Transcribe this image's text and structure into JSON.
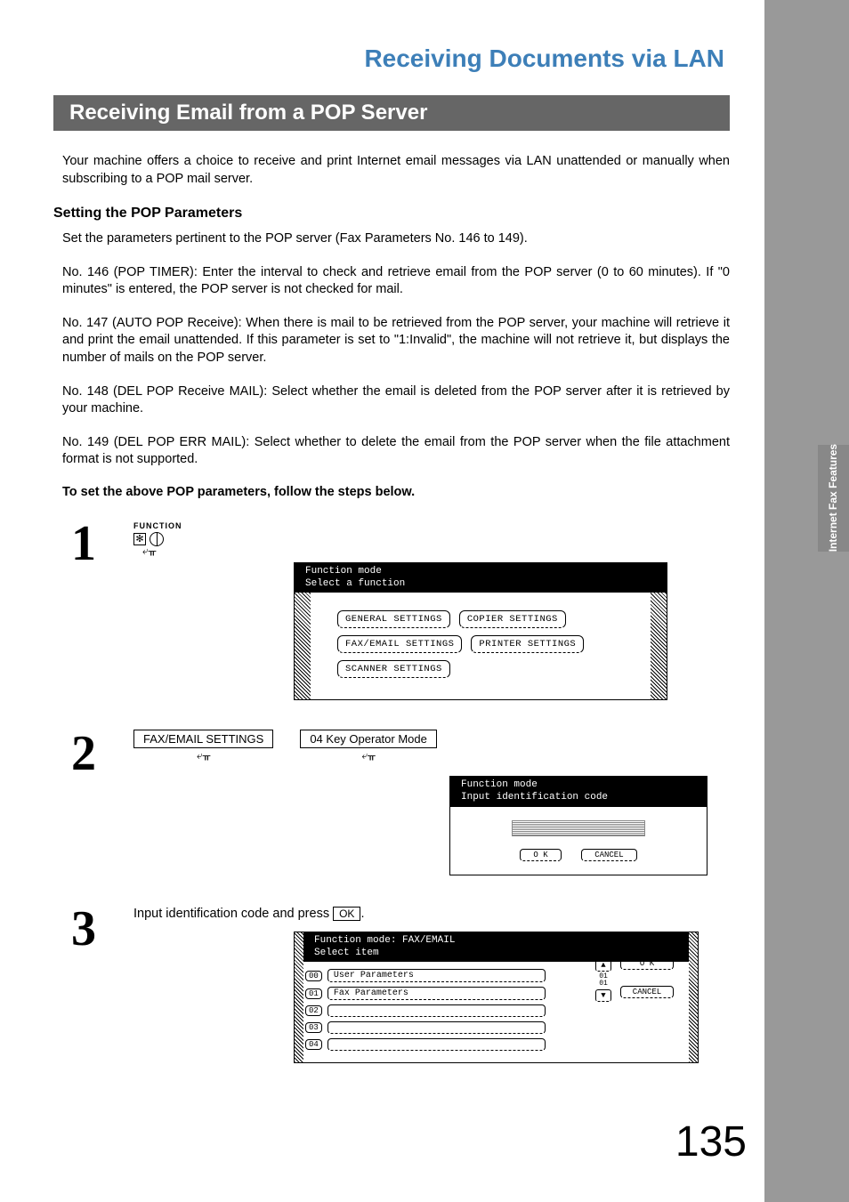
{
  "pageNumber": "135",
  "sideTab": "Internet Fax\nFeatures",
  "mainTitle": "Receiving Documents via LAN",
  "sectionBar": "Receiving Email from a POP Server",
  "intro": "Your machine offers a choice to receive and print Internet email messages via LAN unattended or manually when subscribing to a POP mail server.",
  "subHeading": "Setting the POP Parameters",
  "p1": "Set the parameters pertinent to the POP server (Fax Parameters No. 146 to 149).",
  "p2": "No. 146 (POP TIMER): Enter the interval to check and retrieve email from the POP server (0 to 60 minutes). If \"0 minutes\" is entered, the POP server is not checked for mail.",
  "p3": "No. 147 (AUTO POP Receive): When there is mail to be retrieved from the POP server, your machine will retrieve it and print the email unattended.  If this parameter is set to \"1:Invalid\", the machine will not retrieve it, but displays the number of mails on the POP server.",
  "p4": "No. 148 (DEL POP Receive MAIL): Select whether the email is deleted from the POP server after it is retrieved by your machine.",
  "p5": "No. 149 (DEL POP ERR MAIL): Select whether to delete the email from the POP server when the file attachment format is not supported.",
  "boldLine": "To set the above POP parameters, follow the steps below.",
  "steps": {
    "s1": {
      "num": "1",
      "funcLabel": "FUNCTION"
    },
    "s2": {
      "num": "2",
      "label1": "FAX/EMAIL SETTINGS",
      "label2": "04 Key Operator Mode"
    },
    "s3": {
      "num": "3",
      "textA": "Input identification code and press ",
      "ok": "OK",
      "textB": "."
    }
  },
  "screen1": {
    "hdr1": "Function mode",
    "hdr2": "Select a function",
    "buttons": [
      "GENERAL SETTINGS",
      "COPIER SETTINGS",
      "FAX/EMAIL SETTINGS",
      "PRINTER SETTINGS",
      "SCANNER SETTINGS"
    ]
  },
  "screen2": {
    "hdr1": "Function mode",
    "hdr2": "Input identification code",
    "ok": "O K",
    "cancel": "CANCEL"
  },
  "screen3": {
    "hdr1": "Function mode: FAX/EMAIL",
    "hdr2": "Select item",
    "rows": [
      {
        "n": "00",
        "t": "User Parameters"
      },
      {
        "n": "01",
        "t": "Fax Parameters"
      },
      {
        "n": "02",
        "t": ""
      },
      {
        "n": "03",
        "t": ""
      },
      {
        "n": "04",
        "t": ""
      }
    ],
    "scrollVal": "01\n01",
    "ok": "O K",
    "cancel": "CANCEL"
  }
}
